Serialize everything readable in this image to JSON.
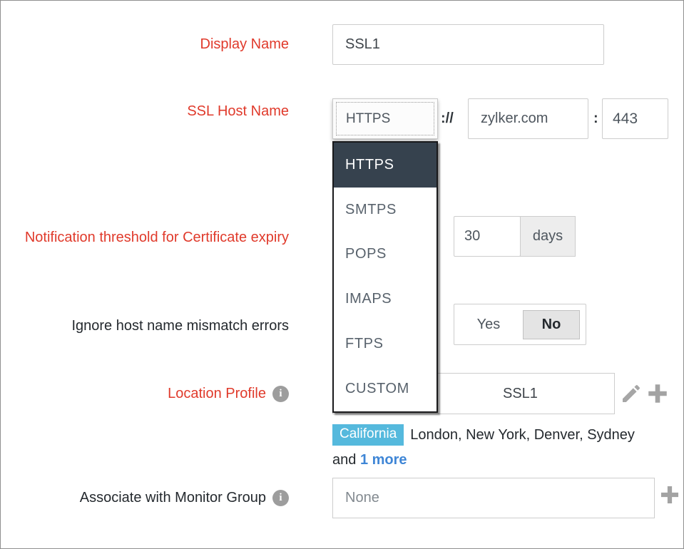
{
  "colors": {
    "label_red": "#e03a2b",
    "text_dark": "#24292e",
    "dropdown_selected_bg": "#36424e",
    "badge_blue": "#55b9dd",
    "link_blue": "#3f86d6",
    "icon_gray": "#a3a3a3",
    "addon_bg": "#ededed",
    "toggle_selected_bg": "#e4e4e4"
  },
  "icons": {
    "info_glyph": "i"
  },
  "form": {
    "display_name": {
      "label": "Display Name",
      "value": "SSL1"
    },
    "ssl_host": {
      "label": "SSL Host Name",
      "protocol": {
        "selected": "HTTPS",
        "highlighted_option": "HTTPS",
        "options": [
          "HTTPS",
          "SMTPS",
          "POPS",
          "IMAPS",
          "FTPS",
          "CUSTOM"
        ]
      },
      "scheme_separator": "://",
      "host": "zylker.com",
      "port_separator": ":",
      "port": "443"
    },
    "threshold": {
      "label": "Notification threshold for Certificate expiry",
      "value": "30",
      "unit": "days"
    },
    "ignore_mismatch": {
      "label": "Ignore host name mismatch errors",
      "options": [
        "Yes",
        "No"
      ],
      "selected": "No"
    },
    "location_profile": {
      "label": "Location Profile",
      "value": "SSL1",
      "badge": "California",
      "other_locations": "London, New York, Denver, Sydney",
      "conjunction": "and",
      "more_link": "1 more"
    },
    "monitor_group": {
      "label": "Associate with Monitor Group",
      "value": "None"
    }
  }
}
